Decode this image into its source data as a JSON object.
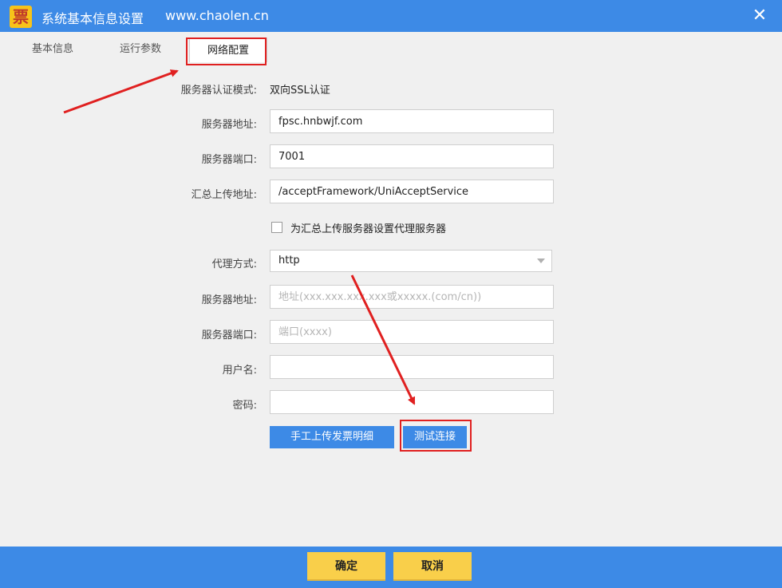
{
  "window": {
    "title": "系统基本信息设置",
    "url": "www.chaolen.cn",
    "logo_text": "票",
    "close_glyph": "✕"
  },
  "tabs": [
    {
      "label": "基本信息"
    },
    {
      "label": "运行参数"
    },
    {
      "label": "网络配置"
    }
  ],
  "form": {
    "auth_mode_label": "服务器认证模式:",
    "auth_mode_value": "双向SSL认证",
    "server_address_label": "服务器地址:",
    "server_address_value": "fpsc.hnbwjf.com",
    "server_port_label": "服务器端口:",
    "server_port_value": "7001",
    "upload_path_label": "汇总上传地址:",
    "upload_path_value": "/acceptFramework/UniAcceptService",
    "proxy_checkbox_label": "为汇总上传服务器设置代理服务器",
    "proxy_mode_label": "代理方式:",
    "proxy_mode_value": "http",
    "proxy_address_label": "服务器地址:",
    "proxy_address_placeholder": "地址(xxx.xxx.xxx.xxx或xxxxx.(com/cn))",
    "proxy_port_label": "服务器端口:",
    "proxy_port_placeholder": "端口(xxxx)",
    "username_label": "用户名:",
    "username_value": "",
    "password_label": "密码:",
    "password_value": ""
  },
  "actions": {
    "manual_upload": "手工上传发票明细",
    "test_connection": "测试连接"
  },
  "footer": {
    "confirm": "确定",
    "cancel": "取消"
  },
  "colors": {
    "primary_blue": "#3d8ae6",
    "button_yellow": "#f9cf4a",
    "annotation_red": "#e02020"
  }
}
